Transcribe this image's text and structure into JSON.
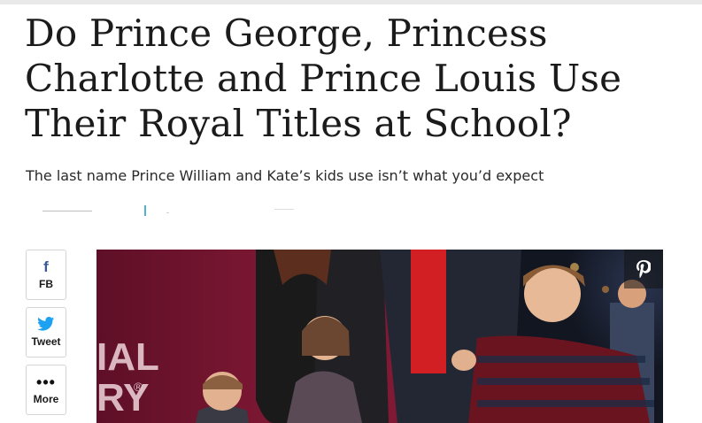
{
  "article": {
    "headline": "Do Prince George, Princess Charlotte and Prince Louis Use Their Royal Titles at School?",
    "subhead": "The last name Prince William and Kate’s kids use isn’t what you’d expect"
  },
  "share": {
    "facebook_label": "FB",
    "twitter_label": "Tweet",
    "more_label": "More"
  },
  "hero_image": {
    "backdrop_text": "IAL RY",
    "backdrop_line1": "IAL",
    "backdrop_line2": "RY",
    "backdrop_mark": "®",
    "icons": {
      "pin": "pinterest-icon"
    }
  },
  "colors": {
    "headline": "#1b1b1b",
    "facebook": "#3b5998",
    "twitter": "#1da1f2",
    "backdrop": "#7a1530"
  }
}
